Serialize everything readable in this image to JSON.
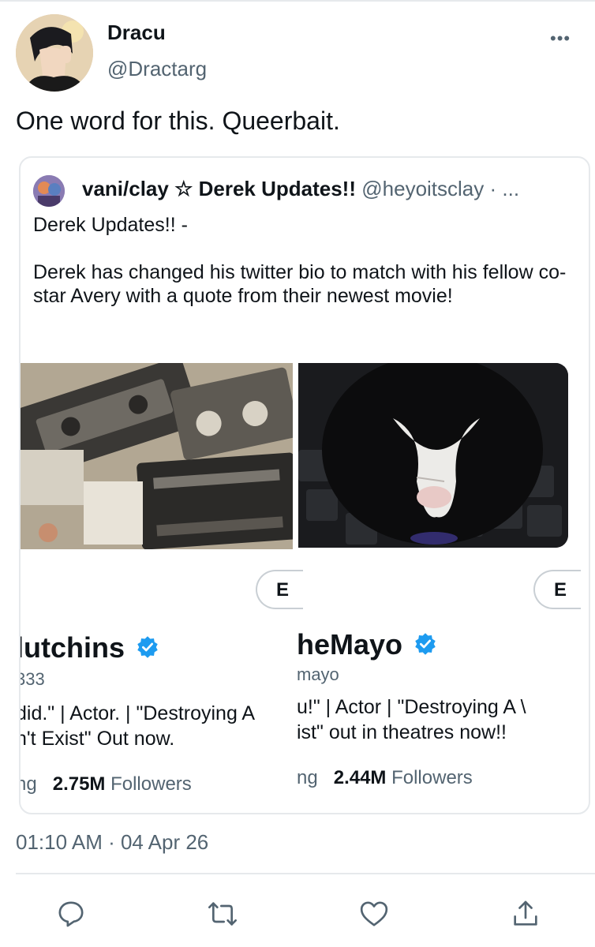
{
  "tweet": {
    "author_name": "Dracu",
    "author_handle": "@Dractarg",
    "text": "One word for this. Queerbait.",
    "timestamp": "01:10 AM · 04 Apr 26",
    "more_label": "•••"
  },
  "quoted": {
    "author_name": "vani/clay ☆ Derek Updates!!",
    "author_handle": "@heyoitsclay · ...",
    "body": "Derek Updates!! -\n\nDerek has changed his twitter bio to match with his fellow co-star Avery with a quote from their newest movie!"
  },
  "profiles": [
    {
      "name": "lutchins",
      "handle": "333",
      "bio": "did.\" | Actor. | \"Destroying A\nn't Exist\" Out now.",
      "following_cut": "ng",
      "followers_count": "2.75M",
      "followers_label": "Followers",
      "button_label": "E"
    },
    {
      "name": "heMayo",
      "handle": "mayo",
      "bio": "u!\" | Actor | \"Destroying A \\\nist\" out in theatres now!!",
      "following_cut": "ng",
      "followers_count": "2.44M",
      "followers_label": "Followers",
      "button_label": "E"
    }
  ],
  "actions": [
    "reply-icon",
    "retweet-icon",
    "like-icon",
    "share-icon"
  ],
  "colors": {
    "verified": "#1d9bf0",
    "secondary_text": "#536471",
    "border": "#e6e9ec"
  }
}
